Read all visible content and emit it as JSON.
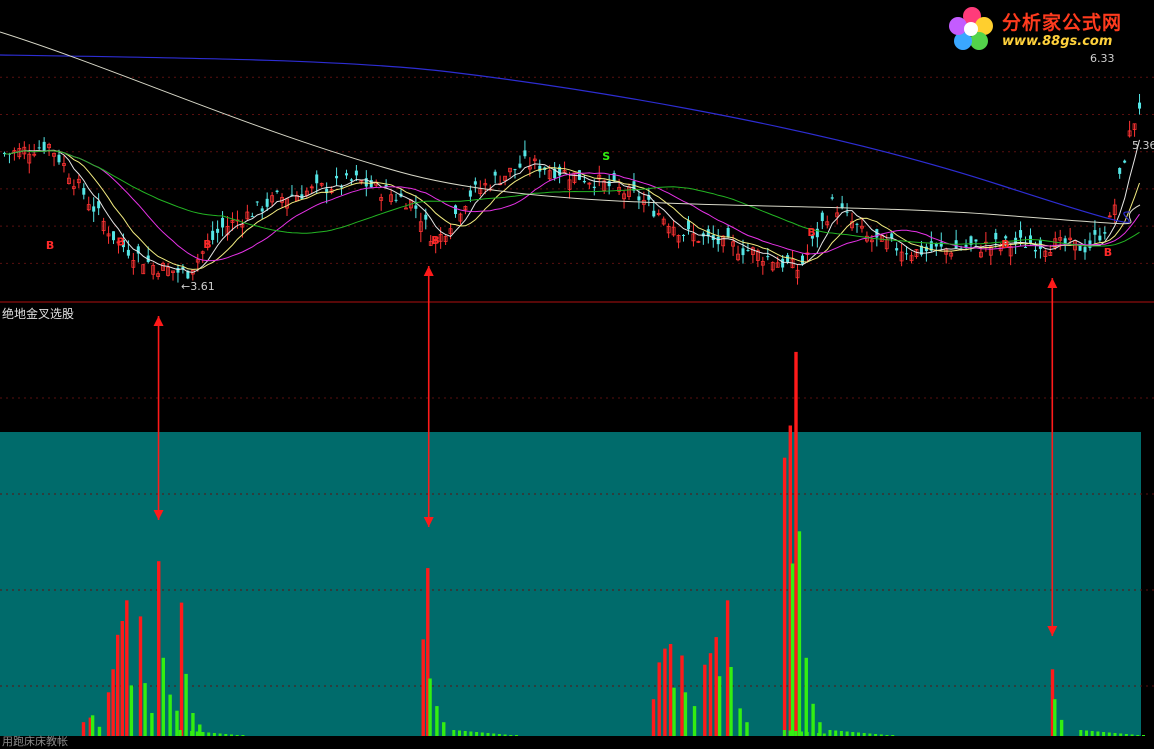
{
  "logo": {
    "name": "分析家公式网",
    "url": "www.88gs.com"
  },
  "indicator_title": "绝地金叉选股",
  "bottom_label": "用跑床床教帐",
  "colors": {
    "background": "#000000",
    "divider": "#b01010",
    "teal_panel": "#006b6b",
    "bar_red": "#ff1a1a",
    "bar_green": "#33ee11",
    "candle_up": "#ff3333",
    "candle_down": "#55e6e6",
    "ma_white": "#e6e6e6",
    "ma_yellow": "#f2ec80",
    "ma_magenta": "#e632e6",
    "ma_green": "#23b423",
    "ma_blue": "#2d2dd2",
    "arrow": "#ff1a1a"
  },
  "chart_data": [
    {
      "type": "candlestick",
      "title": "",
      "price_labels": {
        "high": "6.33",
        "last": "5.36",
        "low": "3.61"
      },
      "price_range": [
        3.61,
        6.33
      ],
      "signals": {
        "buy_marker": "B",
        "sell_marker": "S",
        "buy_positions": [
          4.2,
          10.4,
          18,
          38,
          71,
          88,
          97
        ],
        "sell_positions": [
          53
        ]
      },
      "moving_averages": [
        "ma_white",
        "ma_yellow",
        "ma_magenta",
        "ma_green",
        "ma_blue"
      ]
    },
    {
      "type": "bar",
      "title": "绝地金叉选股",
      "background_band": "teal_panel",
      "series": [
        {
          "values": [
            {
              "pos": 7,
              "h": 0.6
            },
            {
              "pos": 7.6,
              "h": 0.8
            },
            {
              "pos": 9.2,
              "h": 1.9
            },
            {
              "pos": 9.6,
              "h": 2.9
            },
            {
              "pos": 10,
              "h": 4.4
            },
            {
              "pos": 10.4,
              "h": 5.0
            },
            {
              "pos": 10.8,
              "h": 5.9
            },
            {
              "pos": 12,
              "h": 5.2
            },
            {
              "pos": 13.6,
              "h": 7.6
            },
            {
              "pos": 15.6,
              "h": 5.8
            },
            {
              "pos": 36.8,
              "h": 4.2
            },
            {
              "pos": 37.2,
              "h": 7.3
            },
            {
              "pos": 57,
              "h": 1.6
            },
            {
              "pos": 57.5,
              "h": 3.2
            },
            {
              "pos": 58,
              "h": 3.8
            },
            {
              "pos": 58.5,
              "h": 4.0
            },
            {
              "pos": 59.5,
              "h": 3.5
            },
            {
              "pos": 61.5,
              "h": 3.1
            },
            {
              "pos": 62,
              "h": 3.6
            },
            {
              "pos": 62.5,
              "h": 4.3
            },
            {
              "pos": 63.5,
              "h": 5.9
            },
            {
              "pos": 68.5,
              "h": 12.1
            },
            {
              "pos": 69,
              "h": 13.5
            },
            {
              "pos": 69.5,
              "h": 16.7
            },
            {
              "pos": 92,
              "h": 2.9
            }
          ]
        },
        {
          "values": [
            {
              "pos": 7.8,
              "h": 0.9
            },
            {
              "pos": 8.4,
              "h": 0.4
            },
            {
              "pos": 11.2,
              "h": 2.2
            },
            {
              "pos": 12.4,
              "h": 2.3
            },
            {
              "pos": 13,
              "h": 1.0
            },
            {
              "pos": 14,
              "h": 3.4
            },
            {
              "pos": 14.6,
              "h": 1.8
            },
            {
              "pos": 15.2,
              "h": 1.1
            },
            {
              "pos": 16,
              "h": 2.7
            },
            {
              "pos": 16.6,
              "h": 1.0
            },
            {
              "pos": 17.2,
              "h": 0.5
            },
            {
              "pos": 37.4,
              "h": 2.5
            },
            {
              "pos": 38,
              "h": 1.3
            },
            {
              "pos": 38.6,
              "h": 0.6
            },
            {
              "pos": 58.8,
              "h": 2.1
            },
            {
              "pos": 59.8,
              "h": 1.9
            },
            {
              "pos": 60.6,
              "h": 1.3
            },
            {
              "pos": 62.8,
              "h": 2.6
            },
            {
              "pos": 63.8,
              "h": 3.0
            },
            {
              "pos": 64.6,
              "h": 1.2
            },
            {
              "pos": 65.2,
              "h": 0.6
            },
            {
              "pos": 69.2,
              "h": 7.5
            },
            {
              "pos": 69.8,
              "h": 8.9
            },
            {
              "pos": 70.4,
              "h": 3.4
            },
            {
              "pos": 71,
              "h": 1.4
            },
            {
              "pos": 71.6,
              "h": 0.6
            },
            {
              "pos": 92.2,
              "h": 1.6
            },
            {
              "pos": 92.8,
              "h": 0.7
            }
          ]
        }
      ],
      "annotation_positions": [
        13.6,
        37.3,
        69.2,
        92
      ]
    }
  ]
}
